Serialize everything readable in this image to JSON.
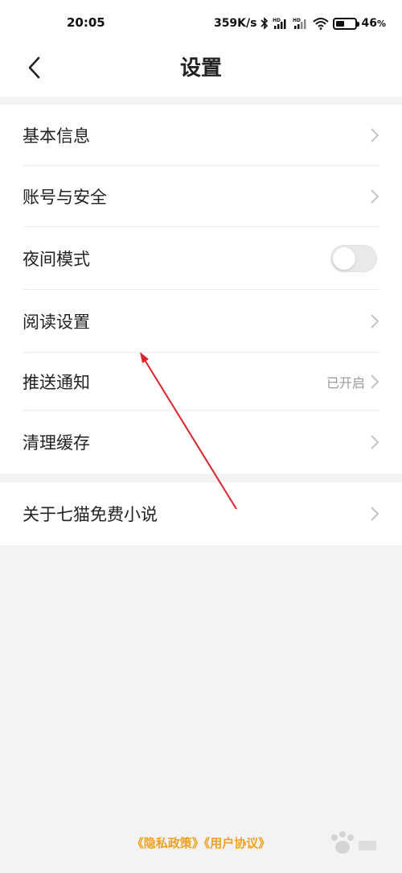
{
  "status_bar": {
    "time": "20:05",
    "network_speed": "359K/s",
    "battery_percent": "46",
    "battery_unit": "%",
    "battery_level": 0.46,
    "icons": [
      "bluetooth-icon",
      "signal-hd-icon",
      "signal-hd-icon",
      "wifi-icon",
      "battery-icon"
    ]
  },
  "header": {
    "back_icon": "chevron-left-icon",
    "title": "设置"
  },
  "settings": {
    "group1": [
      {
        "label": "基本信息",
        "control": "chevron"
      },
      {
        "label": "账号与安全",
        "control": "chevron"
      },
      {
        "label": "夜间模式",
        "control": "toggle",
        "toggle_on": false
      },
      {
        "label": "阅读设置",
        "control": "chevron"
      },
      {
        "label": "推送通知",
        "control": "chevron",
        "status": "已开启"
      },
      {
        "label": "清理缓存",
        "control": "chevron"
      }
    ],
    "group2": [
      {
        "label": "关于七猫免费小说",
        "control": "chevron"
      }
    ]
  },
  "footer": {
    "privacy_link": "《隐私政策》",
    "agreement_link": "《用户协议》"
  },
  "colors": {
    "background": "#f3f3f3",
    "card": "#ffffff",
    "accent": "#f0a020",
    "annotation_arrow": "#d9252b"
  }
}
